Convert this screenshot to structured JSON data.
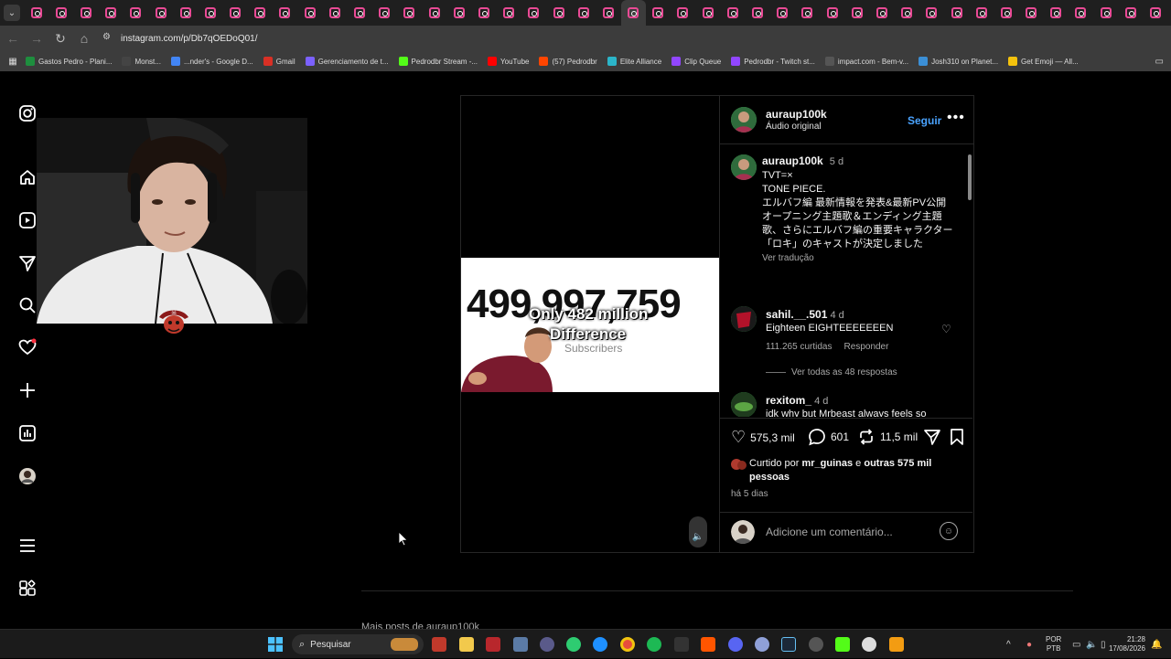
{
  "browser": {
    "url": "instagram.com/p/Db7qOEDoQ01/",
    "tab_count": 46,
    "bookmarks": [
      {
        "label": "Gastos Pedro - Plani...",
        "color": "#1e8e3e"
      },
      {
        "label": "Monst...",
        "color": "#444444"
      },
      {
        "label": "...nder's - Google D...",
        "color": "#4285f4"
      },
      {
        "label": "Gmail",
        "color": "#d93025"
      },
      {
        "label": "Gerenciamento de t...",
        "color": "#7b61ff"
      },
      {
        "label": "Pedrodbr Stream -...",
        "color": "#53fc18"
      },
      {
        "label": "YouTube",
        "color": "#ff0000"
      },
      {
        "label": "(57) Pedrodbr",
        "color": "#ff4500"
      },
      {
        "label": "Elite Alliance",
        "color": "#2bb5c9"
      },
      {
        "label": "Clip Queue",
        "color": "#9146ff"
      },
      {
        "label": "Pedrodbr - Twitch st...",
        "color": "#9146ff"
      },
      {
        "label": "impact.com - Bem-v...",
        "color": "#555555"
      },
      {
        "label": "Josh310 on Planet...",
        "color": "#3b8fd6"
      },
      {
        "label": "Get Emoji — All...",
        "color": "#f4c20d"
      }
    ]
  },
  "post": {
    "username": "auraup100k",
    "audio": "Áudio original",
    "follow_label": "Seguir",
    "caption": {
      "username": "auraup100k",
      "time": "5 d",
      "lines": [
        "TVT=×",
        "TONE PIECE.",
        "エルバフ編 最新情報を発表&最新PV公開",
        "オープニング主題歌＆エンディング主題歌、さらにエルバフ編の重要キャラクター",
        "「ロキ」のキャストが決定しました"
      ],
      "translate": "Ver tradução"
    },
    "comments": [
      {
        "username": "sahil.__.501",
        "time": "4 d",
        "text": "Eighteen EIGHTEEEEEEEN",
        "likes": "111.265 curtidas",
        "reply": "Responder",
        "view_replies": "Ver todas as 48 respostas"
      },
      {
        "username": "rexitom_",
        "time": "4 d",
        "text": "idk why but Mrbeast always feels so"
      }
    ],
    "actions": {
      "likes": "575,3 mil",
      "comments": "601",
      "shares": "11,5 mil"
    },
    "liked_by": {
      "prefix": "Curtido por ",
      "user": "mr_guinas",
      "middle": " e ",
      "others": "outras 575 mil pessoas"
    },
    "posted": "há 5 dias",
    "add_comment_placeholder": "Adicione um comentário...",
    "video": {
      "number": "499,997,759",
      "caption_line1": "Only 482 million",
      "caption_line2": "Difference",
      "subscribers": "Subscribers"
    }
  },
  "more_posts": "Mais posts de auraup100k",
  "taskbar": {
    "search_placeholder": "Pesquisar",
    "lang_top": "POR",
    "lang_bottom": "PTB",
    "time": "21:28",
    "date": "17/08/2026"
  }
}
